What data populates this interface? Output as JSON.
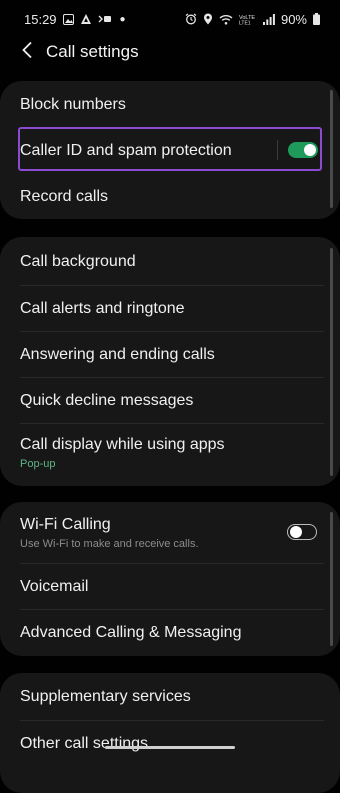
{
  "status_bar": {
    "time": "15:29",
    "left_icons": [
      "gallery-icon",
      "ai-icon",
      "hd-icon"
    ],
    "right_icons": [
      "alarm-icon",
      "location-icon",
      "wifi-icon",
      "volte-icon",
      "signal-icon"
    ],
    "volte_text": "VoLTE",
    "battery": "90%"
  },
  "header": {
    "title": "Call settings",
    "back_icon": "chevron-left-icon"
  },
  "group1": {
    "items": [
      {
        "label": "Block numbers"
      },
      {
        "label": "Caller ID and spam protection",
        "toggle": "on"
      },
      {
        "label": "Record calls"
      }
    ]
  },
  "group2": {
    "items": [
      {
        "label": "Call background"
      },
      {
        "label": "Call alerts and ringtone"
      },
      {
        "label": "Answering and ending calls"
      },
      {
        "label": "Quick decline messages"
      },
      {
        "label": "Call display while using apps",
        "sublabel": "Pop-up"
      }
    ]
  },
  "group3": {
    "items": [
      {
        "label": "Wi-Fi Calling",
        "sublabel": "Use Wi-Fi to make and receive calls.",
        "toggle": "off"
      },
      {
        "label": "Voicemail"
      },
      {
        "label": "Advanced Calling & Messaging"
      }
    ]
  },
  "group4": {
    "items": [
      {
        "label": "Supplementary services"
      },
      {
        "label": "Other call settings"
      }
    ]
  },
  "colors": {
    "background": "#010101",
    "card": "#171717",
    "toggle_on": "#1e9a5b",
    "highlight": "#8a4bd1",
    "sublabel_green": "#5fb589"
  }
}
